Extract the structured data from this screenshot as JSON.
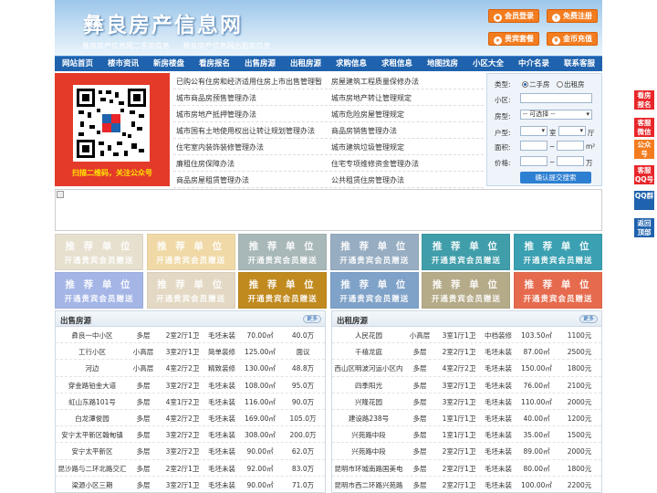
{
  "header": {
    "site_title": "彝良房产信息网",
    "slogan_1": "彝良房产信息网二手房信息",
    "slogan_2": "彝良房产信息网出租房信息",
    "buttons": [
      {
        "label": "会员登录",
        "icon": "user-icon"
      },
      {
        "label": "免费注册",
        "icon": "register-icon"
      },
      {
        "label": "贵宾套餐",
        "icon": "vip-icon"
      },
      {
        "label": "金币充值",
        "icon": "coin-icon"
      }
    ]
  },
  "nav": [
    "网站首页",
    "楼市资讯",
    "新房楼盘",
    "看房报名",
    "出售房源",
    "出租房源",
    "求购信息",
    "求租信息",
    "地图找房",
    "小区大全",
    "中介名录",
    "联系客服"
  ],
  "qr": {
    "caption": "扫描二维码，关注公众号"
  },
  "links": [
    [
      "已购公有住房和经济适用住房上市出售管理暂",
      "房屋建筑工程质量保修办法"
    ],
    [
      "城市商品房预售管理办法",
      "城市房地产转让管理规定"
    ],
    [
      "城市房地产抵押管理办法",
      "城市危险房屋管理规定"
    ],
    [
      "城市国有土地使用权出让转让规划管理办法",
      "商品房销售管理办法"
    ],
    [
      "住宅室内装饰装修管理办法",
      "城市建筑垃圾管理规定"
    ],
    [
      "廉租住房保障办法",
      "住宅专项维修资金管理办法"
    ],
    [
      "商品房屋租赁管理办法",
      "公共租赁住房管理办法"
    ]
  ],
  "search": {
    "type_label": "类型:",
    "type_option_1": "二手房",
    "type_option_2": "出租房",
    "community_label": "小区:",
    "housing_label": "房型:",
    "housing_value": "-- 可选择 --",
    "layout_label": "户型:",
    "room_unit": "室",
    "hall_unit": "厅",
    "area_label": "面积:",
    "area_unit": "m²",
    "price_label": "价格:",
    "price_unit": "万",
    "range_sep": "~",
    "submit": "确认提交搜索"
  },
  "float_nav": [
    "看房报名",
    "客服微信",
    "公众号",
    "客服QQ号",
    "QQ群",
    "返回顶部"
  ],
  "float_colors": [
    "#e8262a",
    "#e8262a",
    "#f37c1f",
    "#e8262a",
    "#1f62ad",
    "#1f62ad"
  ],
  "ad": {
    "line1": "推 荐 单 位",
    "line2": "开通贵宾会员赠送"
  },
  "ad_colors": [
    "#e7e0cf",
    "#f0d9a6",
    "#a8b7b8",
    "#97adc2",
    "#3f9eaa",
    "#3aa0b2",
    "#a4b5e6",
    "#e3d8c3",
    "#c08a1f",
    "#7fa2c8",
    "#b5ab89",
    "#e66b4e"
  ],
  "sale": {
    "title": "出售房源",
    "more": "更多",
    "rows": [
      [
        "彝良一中小区",
        "多层",
        "2室2厅1卫",
        "毛坯未装",
        "70.00㎡",
        "40.0万"
      ],
      [
        "工行小区",
        "小高层",
        "3室2厅1卫",
        "简单装修",
        "125.00㎡",
        "面议"
      ],
      [
        "河边",
        "小高层",
        "4室2厅2卫",
        "精致装修",
        "130.00㎡",
        "48.8万"
      ],
      [
        "穿金路铂金大道",
        "多层",
        "3室2厅2卫",
        "毛坯未装",
        "108.00㎡",
        "95.0万"
      ],
      [
        "虹山东路101号",
        "多层",
        "4室1厅2卫",
        "毛坯未装",
        "116.00㎡",
        "90.0万"
      ],
      [
        "白龙潭俊园",
        "多层",
        "4室2厅2卫",
        "毛坯未装",
        "169.00㎡",
        "105.0万"
      ],
      [
        "安宁太平新区翰甸镇",
        "多层",
        "3室2厅2卫",
        "毛坯未装",
        "308.00㎡",
        "200.0万"
      ],
      [
        "安宁太平新区",
        "多层",
        "3室2厅2卫",
        "毛坯未装",
        "90.00㎡",
        "62.0万"
      ],
      [
        "昆沙路与二环北路交汇",
        "多层",
        "2室2厅1卫",
        "毛坯未装",
        "92.00㎡",
        "83.0万"
      ],
      [
        "梁源小区三期",
        "多层",
        "3室2厅1卫",
        "毛坯未装",
        "90.00㎡",
        "71.0万"
      ]
    ]
  },
  "rent": {
    "title": "出租房源",
    "more": "更多",
    "rows": [
      [
        "人民花园",
        "小高层",
        "3室1厅1卫",
        "中档装修",
        "103.50㎡",
        "1100元"
      ],
      [
        "千禧龙庭",
        "多层",
        "2室2厅1卫",
        "毛坯未装",
        "87.00㎡",
        "2500元"
      ],
      [
        "西山区明波河运小区内",
        "多层",
        "4室2厅2卫",
        "毛坯未装",
        "150.00㎡",
        "1800元"
      ],
      [
        "四季阳光",
        "多层",
        "3室2厅1卫",
        "毛坯未装",
        "76.00㎡",
        "2100元"
      ],
      [
        "兴隆花园",
        "多层",
        "3室2厅1卫",
        "毛坯未装",
        "110.00㎡",
        "2000元"
      ],
      [
        "建设路238号",
        "多层",
        "1室1厅1卫",
        "毛坯未装",
        "40.00㎡",
        "1200元"
      ],
      [
        "兴苑路中段",
        "多层",
        "1室1厅1卫",
        "毛坯未装",
        "35.00㎡",
        "1500元"
      ],
      [
        "兴苑路中段",
        "多层",
        "2室2厅1卫",
        "毛坯未装",
        "89.00㎡",
        "2000元"
      ],
      [
        "昆明市环城南路国美电",
        "多层",
        "2室2厅1卫",
        "毛坯未装",
        "80.00㎡",
        "1800元"
      ],
      [
        "昆明市西二环路兴苑路",
        "多层",
        "2室2厅1卫",
        "毛坯未装",
        "100.00㎡",
        "2200元"
      ]
    ]
  }
}
